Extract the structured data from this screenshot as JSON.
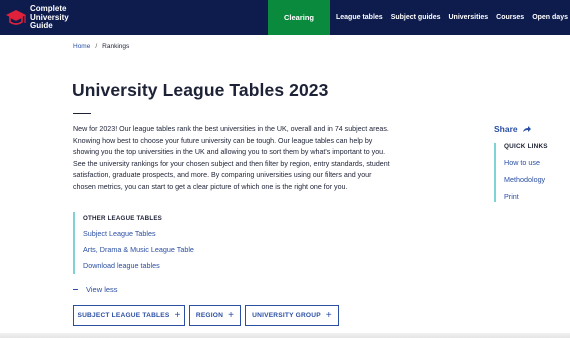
{
  "header": {
    "logo_lines": [
      "Complete",
      "University",
      "Guide"
    ],
    "clearing": "Clearing",
    "nav": [
      "League tables",
      "Subject guides",
      "Universities",
      "Courses",
      "Open days"
    ]
  },
  "breadcrumb": {
    "home": "Home",
    "separator": "/",
    "current": "Rankings"
  },
  "page": {
    "title": "University League Tables 2023",
    "intro": "New for 2023! Our league tables rank the best universities in the UK, overall and in 74 subject areas. Knowing how best to choose your future university can be tough. Our league tables can help by showing you the top universities in the UK and allowing you to sort them by what's important to you. See the university rankings for your chosen subject and then filter by region, entry standards, student satisfaction, graduate prospects, and more. By comparing universities using our filters and your chosen metrics, you can start to get a clear picture of which one is the right one for you."
  },
  "other_tables": {
    "heading": "OTHER LEAGUE TABLES",
    "links": [
      "Subject League Tables",
      "Arts, Drama & Music League Table",
      "Download league tables"
    ]
  },
  "view_less": "View less",
  "filters": [
    "SUBJECT LEAGUE TABLES",
    "REGION",
    "UNIVERSITY GROUP"
  ],
  "sidebar": {
    "share": "Share",
    "quick_links_heading": "QUICK LINKS",
    "quick_links": [
      "How to use",
      "Methodology",
      "Print"
    ]
  },
  "colors": {
    "navy": "#0d1b4d",
    "green": "#0a8a3d",
    "link": "#2b4fa3",
    "teal": "#7fd3d3",
    "text": "#1d2236"
  }
}
